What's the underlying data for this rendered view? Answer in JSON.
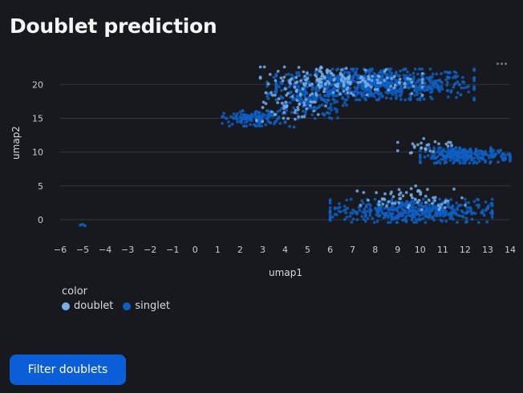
{
  "page": {
    "title": "Doublet prediction"
  },
  "toolbar": {
    "more_icon": "more-horizontal-icon"
  },
  "chart_data": {
    "type": "scatter",
    "title": "",
    "xlabel": "umap1",
    "ylabel": "umap2",
    "xlim": [
      -6,
      14
    ],
    "ylim": [
      -2.5,
      23
    ],
    "x_ticks": [
      "−6",
      "−5",
      "−4",
      "−3",
      "−2",
      "−1",
      "0",
      "1",
      "2",
      "3",
      "4",
      "5",
      "6",
      "7",
      "8",
      "9",
      "10",
      "11",
      "12",
      "13",
      "14"
    ],
    "y_ticks": [
      "0",
      "5",
      "10",
      "15",
      "20"
    ],
    "grid": "horizontal",
    "legend": {
      "title": "color",
      "position": "bottom-left",
      "entries": [
        {
          "name": "doublet",
          "color": "#76aee8"
        },
        {
          "name": "singlet",
          "color": "#0e5fc4"
        }
      ]
    },
    "series": [
      {
        "name": "singlet",
        "color": "#0e5fc4",
        "clusters": [
          {
            "cx": 8.0,
            "cy": 20.0,
            "sx": 2.2,
            "sy": 1.2,
            "n": 700
          },
          {
            "cx": 5.0,
            "cy": 18.0,
            "sx": 0.9,
            "sy": 1.6,
            "n": 180
          },
          {
            "cx": 2.6,
            "cy": 15.0,
            "sx": 0.7,
            "sy": 0.6,
            "n": 130
          },
          {
            "cx": 12.0,
            "cy": 9.5,
            "sx": 1.0,
            "sy": 0.6,
            "n": 260
          },
          {
            "cx": 9.6,
            "cy": 1.3,
            "sx": 1.8,
            "sy": 0.9,
            "n": 460
          }
        ],
        "outliers": [
          [
            -5.0,
            -0.7
          ],
          [
            -4.9,
            -0.9
          ],
          [
            -5.1,
            -0.8
          ],
          [
            4.2,
            13.8
          ],
          [
            4.4,
            13.7
          ],
          [
            10.8,
            19.3
          ]
        ]
      },
      {
        "name": "doublet",
        "color": "#76aee8",
        "clusters": [
          {
            "cx": 6.5,
            "cy": 20.5,
            "sx": 1.8,
            "sy": 1.1,
            "n": 180
          },
          {
            "cx": 4.2,
            "cy": 16.8,
            "sx": 0.8,
            "sy": 1.2,
            "n": 45
          },
          {
            "cx": 10.2,
            "cy": 11.0,
            "sx": 0.6,
            "sy": 0.6,
            "n": 25
          },
          {
            "cx": 9.6,
            "cy": 3.0,
            "sx": 1.2,
            "sy": 0.8,
            "n": 60
          }
        ],
        "outliers": [
          [
            9.8,
            5.0
          ],
          [
            9.6,
            4.6
          ],
          [
            9.9,
            4.2
          ],
          [
            3.0,
            16.6
          ]
        ]
      }
    ]
  },
  "actions": {
    "filter_label": "Filter doublets"
  }
}
